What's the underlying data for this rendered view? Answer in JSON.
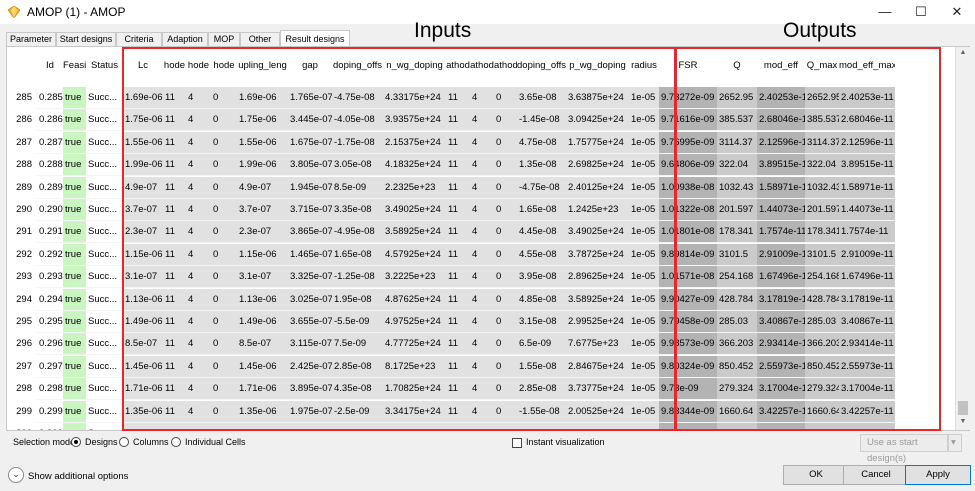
{
  "window": {
    "title": "AMOP (1) - AMOP",
    "minimize": "—",
    "maximize": "☐",
    "close": "✕"
  },
  "tabs": [
    {
      "label": "Parameter"
    },
    {
      "label": "Start designs"
    },
    {
      "label": "Criteria"
    },
    {
      "label": "Adaption"
    },
    {
      "label": "MOP"
    },
    {
      "label": "Other"
    },
    {
      "label": "Result designs",
      "active": true
    }
  ],
  "annotations": {
    "inputs": "Inputs",
    "outputs": "Outputs"
  },
  "colors": {
    "accent_box": "#e8262b",
    "feasible_bg": "#c8f5c0",
    "input_bg": "#e1e1e1",
    "output_bg": "#cacaca",
    "output_bg_dark": "#b3b3b3"
  },
  "table": {
    "columns": [
      "Id",
      "Feasib",
      "Status",
      "Lc",
      "hode",
      "hode",
      "hode",
      "upling_leng",
      "gap",
      "doping_offs",
      "n_wg_doping",
      "athod",
      "athod",
      "athod",
      "doping_offs",
      "p_wg_doping",
      "radius",
      "FSR",
      "Q",
      "mod_eff",
      "Q_max",
      "mod_eff_max"
    ],
    "rows": [
      {
        "row_num": "285",
        "cells": [
          "0.285",
          "true",
          "Succ...",
          "1.69e-06",
          "11",
          "4",
          "0",
          "1.69e-06",
          "1.765e-07",
          "-4.75e-08",
          "4.33175e+24",
          "11",
          "4",
          "0",
          "3.65e-08",
          "3.63875e+24",
          "1e-05",
          "9.73272e-09",
          "2652.95",
          "2.40253e-11",
          "2652.95",
          "2.40253e-11"
        ]
      },
      {
        "row_num": "286",
        "cells": [
          "0.286",
          "true",
          "Succ...",
          "1.75e-06",
          "11",
          "4",
          "0",
          "1.75e-06",
          "3.445e-07",
          "-4.05e-08",
          "3.93575e+24",
          "11",
          "4",
          "0",
          "-1.45e-08",
          "3.09425e+24",
          "1e-05",
          "9.71616e-09",
          "385.537",
          "2.68046e-11",
          "385.537",
          "2.68046e-11"
        ]
      },
      {
        "row_num": "287",
        "cells": [
          "0.287",
          "true",
          "Succ...",
          "1.55e-06",
          "11",
          "4",
          "0",
          "1.55e-06",
          "1.675e-07",
          "-1.75e-08",
          "2.15375e+24",
          "11",
          "4",
          "0",
          "4.75e-08",
          "1.75775e+24",
          "1e-05",
          "9.76995e-09",
          "3114.37",
          "2.12596e-11",
          "3114.37",
          "2.12596e-11"
        ]
      },
      {
        "row_num": "288",
        "cells": [
          "0.288",
          "true",
          "Succ...",
          "1.99e-06",
          "11",
          "4",
          "0",
          "1.99e-06",
          "3.805e-07",
          "3.05e-08",
          "4.18325e+24",
          "11",
          "4",
          "0",
          "1.35e-08",
          "2.69825e+24",
          "1e-05",
          "9.64806e-09",
          "322.04",
          "3.89515e-11",
          "322.04",
          "3.89515e-11"
        ]
      },
      {
        "row_num": "289",
        "cells": [
          "0.289",
          "true",
          "Succ...",
          "4.9e-07",
          "11",
          "4",
          "0",
          "4.9e-07",
          "1.945e-07",
          "8.5e-09",
          "2.2325e+23",
          "11",
          "4",
          "0",
          "-4.75e-08",
          "2.40125e+24",
          "1e-05",
          "1.00938e-08",
          "1032.43",
          "1.58971e-11",
          "1032.43",
          "1.58971e-11"
        ]
      },
      {
        "row_num": "290",
        "cells": [
          "0.290",
          "true",
          "Succ...",
          "3.7e-07",
          "11",
          "4",
          "0",
          "3.7e-07",
          "3.715e-07",
          "3.35e-08",
          "3.49025e+24",
          "11",
          "4",
          "0",
          "1.65e-08",
          "1.2425e+23",
          "1e-05",
          "1.01322e-08",
          "201.597",
          "1.44073e-11",
          "201.597",
          "1.44073e-11"
        ]
      },
      {
        "row_num": "291",
        "cells": [
          "0.291",
          "true",
          "Succ...",
          "2.3e-07",
          "11",
          "4",
          "0",
          "2.3e-07",
          "3.865e-07",
          "-4.95e-08",
          "3.58925e+24",
          "11",
          "4",
          "0",
          "4.45e-08",
          "3.49025e+24",
          "1e-05",
          "1.01801e-08",
          "178.341",
          "1.7574e-11",
          "178.341",
          "1.7574e-11"
        ]
      },
      {
        "row_num": "292",
        "cells": [
          "0.292",
          "true",
          "Succ...",
          "1.15e-06",
          "11",
          "4",
          "0",
          "1.15e-06",
          "1.465e-07",
          "1.65e-08",
          "4.57925e+24",
          "11",
          "4",
          "0",
          "4.55e-08",
          "3.78725e+24",
          "1e-05",
          "9.89814e-09",
          "3101.5",
          "2.91009e-11",
          "3101.5",
          "2.91009e-11"
        ]
      },
      {
        "row_num": "293",
        "cells": [
          "0.293",
          "true",
          "Succ...",
          "3.1e-07",
          "11",
          "4",
          "0",
          "3.1e-07",
          "3.325e-07",
          "-1.25e-08",
          "3.2225e+23",
          "11",
          "4",
          "0",
          "3.95e-08",
          "2.89625e+24",
          "1e-05",
          "1.01571e-08",
          "254.168",
          "1.67496e-11",
          "254.168",
          "1.67496e-11"
        ]
      },
      {
        "row_num": "294",
        "cells": [
          "0.294",
          "true",
          "Succ...",
          "1.13e-06",
          "11",
          "4",
          "0",
          "1.13e-06",
          "3.025e-07",
          "1.95e-08",
          "4.87625e+24",
          "11",
          "4",
          "0",
          "4.85e-08",
          "3.58925e+24",
          "1e-05",
          "9.90427e-09",
          "428.784",
          "3.17819e-11",
          "428.784",
          "3.17819e-11"
        ]
      },
      {
        "row_num": "295",
        "cells": [
          "0.295",
          "true",
          "Succ...",
          "1.49e-06",
          "11",
          "4",
          "0",
          "1.49e-06",
          "3.655e-07",
          "-5.5e-09",
          "4.97525e+24",
          "11",
          "4",
          "0",
          "3.15e-08",
          "2.99525e+24",
          "1e-05",
          "9.79458e-09",
          "285.03",
          "3.40867e-11",
          "285.03",
          "3.40867e-11"
        ]
      },
      {
        "row_num": "296",
        "cells": [
          "0.296",
          "true",
          "Succ...",
          "8.5e-07",
          "11",
          "4",
          "0",
          "8.5e-07",
          "3.115e-07",
          "7.5e-09",
          "4.77725e+24",
          "11",
          "4",
          "0",
          "6.5e-09",
          "7.6775e+23",
          "1e-05",
          "9.98573e-09",
          "366.203",
          "2.93414e-11",
          "366.203",
          "2.93414e-11"
        ]
      },
      {
        "row_num": "297",
        "cells": [
          "0.297",
          "true",
          "Succ...",
          "1.45e-06",
          "11",
          "4",
          "0",
          "1.45e-06",
          "2.425e-07",
          "2.85e-08",
          "8.1725e+23",
          "11",
          "4",
          "0",
          "1.55e-08",
          "2.84675e+24",
          "1e-05",
          "9.80324e-09",
          "850.452",
          "2.55973e-11",
          "850.452",
          "2.55973e-11"
        ]
      },
      {
        "row_num": "298",
        "cells": [
          "0.298",
          "true",
          "Succ...",
          "1.71e-06",
          "11",
          "4",
          "0",
          "1.71e-06",
          "3.895e-07",
          "4.35e-08",
          "1.70825e+24",
          "11",
          "4",
          "0",
          "2.85e-08",
          "3.73775e+24",
          "1e-05",
          "9.73e-09",
          "279.324",
          "3.17004e-11",
          "279.324",
          "3.17004e-11"
        ]
      },
      {
        "row_num": "299",
        "cells": [
          "0.299",
          "true",
          "Succ...",
          "1.35e-06",
          "11",
          "4",
          "0",
          "1.35e-06",
          "1.975e-07",
          "-2.5e-09",
          "3.34175e+24",
          "11",
          "4",
          "0",
          "-1.55e-08",
          "2.00525e+24",
          "1e-05",
          "9.83344e-09",
          "1660.64",
          "3.42257e-11",
          "1660.64",
          "3.42257e-11"
        ]
      },
      {
        "row_num": "300",
        "cells": [
          "0.300",
          "true",
          "Succ...",
          "1.01e-06",
          "11",
          "4",
          "0",
          "1.01e-06",
          "1.165e-07",
          "-2.85e-08",
          "4.03475e+24",
          "11",
          "4",
          "0",
          "3.05e-08",
          "5.6975e+23",
          "1e-05",
          "9.93553e-09",
          "4897.02",
          "2.31492e-11",
          "4897.02",
          "2.31492e-11"
        ]
      }
    ]
  },
  "footer": {
    "selection_mode_label": "Selection mode:",
    "modes": [
      "Designs",
      "Columns",
      "Individual Cells"
    ],
    "selected_mode": "Designs",
    "instant_visualization": "Instant visualization",
    "use_as_start": "Use as start design(s)",
    "show_additional": "Show additional options",
    "ok": "OK",
    "cancel": "Cancel",
    "apply": "Apply"
  }
}
